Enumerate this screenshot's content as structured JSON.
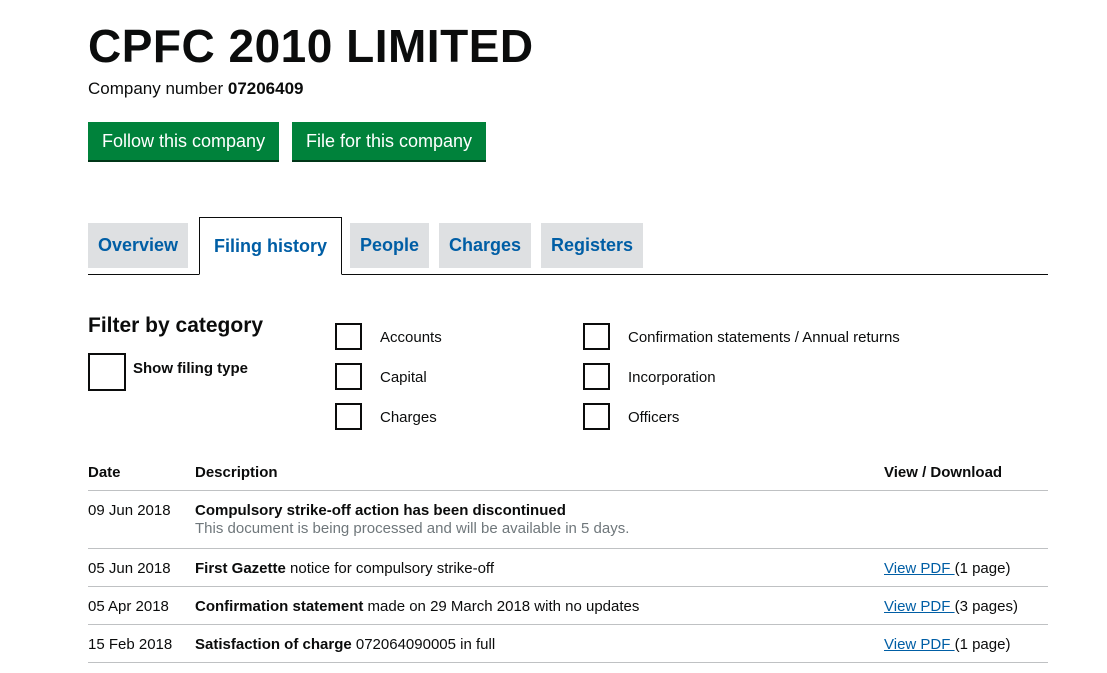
{
  "company": {
    "name": "CPFC 2010 LIMITED",
    "number_label": "Company number",
    "number": "07206409"
  },
  "actions": {
    "follow_label": "Follow this company",
    "file_label": "File for this company"
  },
  "tabs": [
    {
      "label": "Overview",
      "active": false
    },
    {
      "label": "Filing history",
      "active": true
    },
    {
      "label": "People",
      "active": false
    },
    {
      "label": "Charges",
      "active": false
    },
    {
      "label": "Registers",
      "active": false
    }
  ],
  "filter": {
    "title": "Filter by category",
    "show_filing_type": "Show filing type",
    "categories": [
      "Accounts",
      "Capital",
      "Charges",
      "Confirmation statements / Annual returns",
      "Incorporation",
      "Officers"
    ]
  },
  "table": {
    "headers": {
      "date": "Date",
      "description": "Description",
      "view": "View / Download"
    },
    "rows": [
      {
        "date": "09 Jun 2018",
        "desc_bold": "Compulsory strike-off action has been discontinued",
        "desc_rest": "",
        "note": "This document is being processed and will be available in 5 days.",
        "link": "",
        "pages": ""
      },
      {
        "date": "05 Jun 2018",
        "desc_bold": "First Gazette",
        "desc_rest": " notice for compulsory strike-off",
        "note": "",
        "link": "View PDF ",
        "pages": "(1 page)"
      },
      {
        "date": "05 Apr 2018",
        "desc_bold": "Confirmation statement",
        "desc_rest": " made on 29 March 2018 with no updates",
        "note": "",
        "link": "View PDF ",
        "pages": "(3 pages)"
      },
      {
        "date": "15 Feb 2018",
        "desc_bold": "Satisfaction of charge",
        "desc_rest": " 072064090005 in full",
        "note": "",
        "link": "View PDF ",
        "pages": "(1 page)"
      }
    ]
  },
  "colors": {
    "primary_button": "#00823b",
    "link": "#005ea5",
    "tab_bg": "#dee0e2"
  }
}
